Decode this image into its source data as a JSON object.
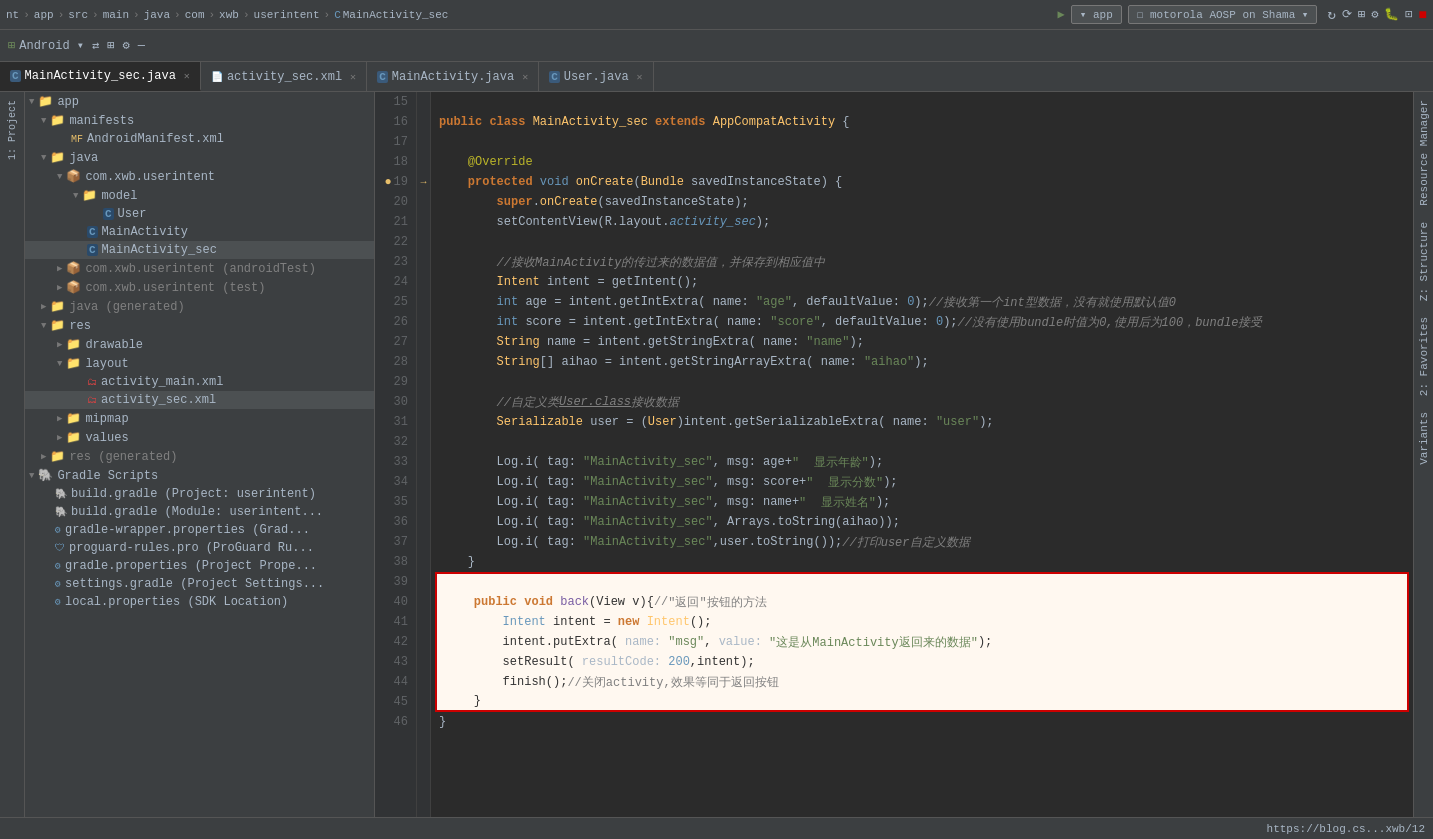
{
  "breadcrumb": {
    "items": [
      "nt",
      "app",
      "src",
      "main",
      "java",
      "com",
      "xwb",
      "userintent",
      "MainActivity_sec"
    ]
  },
  "topbar": {
    "app_label": "▾ app",
    "device_label": "motorola AOSP on Shama ▾"
  },
  "android_bar": {
    "label": "Android ▾"
  },
  "tabs": [
    {
      "label": "MainActivity_sec.java",
      "type": "java",
      "active": true
    },
    {
      "label": "activity_sec.xml",
      "type": "xml",
      "active": false
    },
    {
      "label": "MainActivity.java",
      "type": "java",
      "active": false
    },
    {
      "label": "User.java",
      "type": "java",
      "active": false
    }
  ],
  "sidebar": {
    "items": [
      {
        "label": "app",
        "indent": 0,
        "type": "folder",
        "expanded": true
      },
      {
        "label": "manifests",
        "indent": 1,
        "type": "folder",
        "expanded": true
      },
      {
        "label": "AndroidManifest.xml",
        "indent": 2,
        "type": "xml-file"
      },
      {
        "label": "java",
        "indent": 1,
        "type": "folder",
        "expanded": true
      },
      {
        "label": "com.xwb.userintent",
        "indent": 2,
        "type": "package",
        "expanded": true
      },
      {
        "label": "model",
        "indent": 3,
        "type": "folder",
        "expanded": true
      },
      {
        "label": "User",
        "indent": 4,
        "type": "java-file"
      },
      {
        "label": "MainActivity",
        "indent": 3,
        "type": "java-file"
      },
      {
        "label": "MainActivity_sec",
        "indent": 3,
        "type": "java-file"
      },
      {
        "label": "com.xwb.userintent (androidTest)",
        "indent": 2,
        "type": "package-gray"
      },
      {
        "label": "com.xwb.userintent (test)",
        "indent": 2,
        "type": "package-gray"
      },
      {
        "label": "java (generated)",
        "indent": 1,
        "type": "folder-gray"
      },
      {
        "label": "res",
        "indent": 1,
        "type": "folder",
        "expanded": true
      },
      {
        "label": "drawable",
        "indent": 2,
        "type": "folder",
        "expanded": false
      },
      {
        "label": "layout",
        "indent": 2,
        "type": "folder",
        "expanded": true
      },
      {
        "label": "activity_main.xml",
        "indent": 3,
        "type": "xml-file"
      },
      {
        "label": "activity_sec.xml",
        "indent": 3,
        "type": "xml-file-active"
      },
      {
        "label": "mipmap",
        "indent": 2,
        "type": "folder",
        "expanded": false
      },
      {
        "label": "values",
        "indent": 2,
        "type": "folder",
        "expanded": false
      },
      {
        "label": "res (generated)",
        "indent": 1,
        "type": "folder-gray"
      },
      {
        "label": "Gradle Scripts",
        "indent": 0,
        "type": "gradle",
        "expanded": true
      },
      {
        "label": "build.gradle (Project: userintent)",
        "indent": 1,
        "type": "gradle-file"
      },
      {
        "label": "build.gradle (Module: userintent...)",
        "indent": 1,
        "type": "gradle-file"
      },
      {
        "label": "gradle-wrapper.properties (Grad...)",
        "indent": 1,
        "type": "gradle-file"
      },
      {
        "label": "proguard-rules.pro (ProGuard Ru...)",
        "indent": 1,
        "type": "gradle-file"
      },
      {
        "label": "gradle.properties (Project Prope...)",
        "indent": 1,
        "type": "gradle-file"
      },
      {
        "label": "settings.gradle (Project Settings...)",
        "indent": 1,
        "type": "gradle-file"
      },
      {
        "label": "local.properties (SDK Location)",
        "indent": 1,
        "type": "gradle-file"
      }
    ]
  },
  "code": {
    "lines": [
      {
        "num": 15,
        "content": ""
      },
      {
        "num": 16,
        "content": "public_class_MainActivity_sec_extends_AppCompatActivity_{"
      },
      {
        "num": 17,
        "content": ""
      },
      {
        "num": 18,
        "content": "    @Override"
      },
      {
        "num": 19,
        "content": "    protected_void_onCreate_Bundle_savedInstanceState_{",
        "has_bookmark": true
      },
      {
        "num": 20,
        "content": "        super.onCreate(savedInstanceState);"
      },
      {
        "num": 21,
        "content": "        setContentView(R.layout.activity_sec);"
      },
      {
        "num": 22,
        "content": ""
      },
      {
        "num": 23,
        "content": "        //接收MainActivity的传过来的数据值，并保存到相应值中"
      },
      {
        "num": 24,
        "content": "        Intent intent = getIntent();"
      },
      {
        "num": 25,
        "content": "        int age = intent.getIntExtra( name: \"age\", defaultValue: 0);//接收第一个int型数据，没有就使用默认值0"
      },
      {
        "num": 26,
        "content": "        int score = intent.getIntExtra( name: \"score\", defaultValue: 0);//没有使用bundle时值为0,使用后为100，bundle接受"
      },
      {
        "num": 27,
        "content": "        String name = intent.getStringExtra( name: \"name\");"
      },
      {
        "num": 28,
        "content": "        String[] aihao = intent.getStringArrayExtra( name: \"aihao\");"
      },
      {
        "num": 29,
        "content": ""
      },
      {
        "num": 30,
        "content": "        //自定义类User.class接收数据"
      },
      {
        "num": 31,
        "content": "        Serializable user = (User)intent.getSerializableExtra( name: \"user\");"
      },
      {
        "num": 32,
        "content": ""
      },
      {
        "num": 33,
        "content": "        Log.i( tag: \"MainActivity_sec\", msg: age+\"  显示年龄\");"
      },
      {
        "num": 34,
        "content": "        Log.i( tag: \"MainActivity_sec\", msg: score+\"  显示分数\");"
      },
      {
        "num": 35,
        "content": "        Log.i( tag: \"MainActivity_sec\", msg: name+\"  显示姓名\");"
      },
      {
        "num": 36,
        "content": "        Log.i( tag: \"MainActivity_sec\", Arrays.toString(aihao));"
      },
      {
        "num": 37,
        "content": "        Log.i( tag: \"MainActivity_sec\",user.toString());//打印user自定义数据"
      },
      {
        "num": 38,
        "content": "    }"
      },
      {
        "num": 39,
        "content": "",
        "highlight_block_start": true
      },
      {
        "num": 40,
        "content": "    public void back(View v){//\"返回\"按钮的方法",
        "in_block": true
      },
      {
        "num": 41,
        "content": "        Intent intent = new Intent();",
        "in_block": true
      },
      {
        "num": 42,
        "content": "        intent.putExtra( name: \"msg\", value: \"这是从MainActivity返回来的数据\");",
        "in_block": true
      },
      {
        "num": 43,
        "content": "        setResult( resultCode: 200,intent);",
        "in_block": true
      },
      {
        "num": 44,
        "content": "        finish();//关闭activity,效果等同于返回按钮",
        "in_block": true
      },
      {
        "num": 45,
        "content": "    }",
        "in_block": true,
        "highlight_block_end": true
      },
      {
        "num": 46,
        "content": "}"
      }
    ]
  },
  "status_bar": {
    "left": "",
    "right": "https://blog.cs...xwb/12"
  },
  "left_sidebar_tabs": [
    "1: Project"
  ],
  "right_sidebar_tabs": [
    "Resource Manager",
    "Z: Structure",
    "2: Favorites",
    "Variants"
  ]
}
